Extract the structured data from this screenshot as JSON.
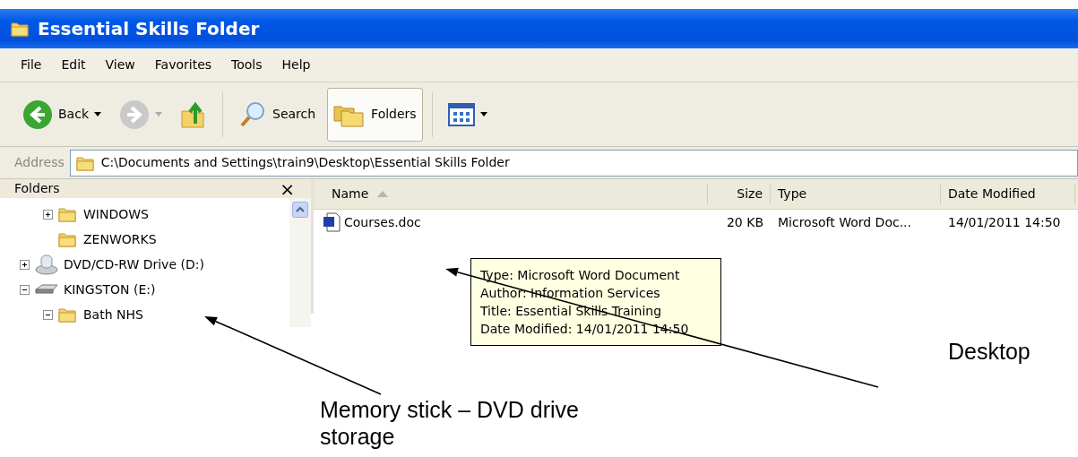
{
  "window": {
    "title": "Essential Skills Folder"
  },
  "menu": [
    "File",
    "Edit",
    "View",
    "Favorites",
    "Tools",
    "Help"
  ],
  "toolbar": [
    {
      "kind": "back",
      "label": "Back"
    },
    {
      "kind": "forward"
    },
    {
      "kind": "up"
    },
    {
      "kind": "search",
      "label": "Search"
    },
    {
      "kind": "folders",
      "label": "Folders",
      "selected": true
    },
    {
      "kind": "views"
    }
  ],
  "address": {
    "label": "Address",
    "value": "C:\\Documents and Settings\\train9\\Desktop\\Essential Skills Folder"
  },
  "folders_pane": {
    "title": "Folders",
    "close": "×",
    "tree": [
      {
        "children": [
          {
            "kind": "folder",
            "label": "WINDOWS",
            "expanded": false
          },
          {
            "kind": "folder",
            "label": "ZENWORKS"
          }
        ]
      },
      {
        "kind": "dvd",
        "label": "DVD/CD-RW Drive (D:)",
        "expanded": false
      },
      {
        "kind": "drive",
        "label": "KINGSTON (E:)",
        "expanded": true,
        "children": [
          {
            "kind": "folder",
            "label": "Bath NHS",
            "expanded": true
          }
        ]
      }
    ]
  },
  "file_list": {
    "columns": [
      {
        "label": "Name",
        "sorted": true
      },
      {
        "label": "Size",
        "sorted": false
      },
      {
        "label": "Type",
        "sorted": false
      },
      {
        "label": "Date Modified",
        "sorted": false
      }
    ],
    "rows": [
      {
        "name": "Courses.doc",
        "size": "20 KB",
        "type": "Microsoft Word Doc...",
        "date_modified": "14/01/2011 14:50"
      }
    ]
  },
  "tooltip": [
    "Type: Microsoft Word Document",
    "Author: Information Services",
    "Title: Essential Skills Training",
    "Date Modified: 14/01/2011 14:50"
  ],
  "desktop_annotation": "Desktop",
  "drive_annotation": "Memory stick – DVD drive storage"
}
